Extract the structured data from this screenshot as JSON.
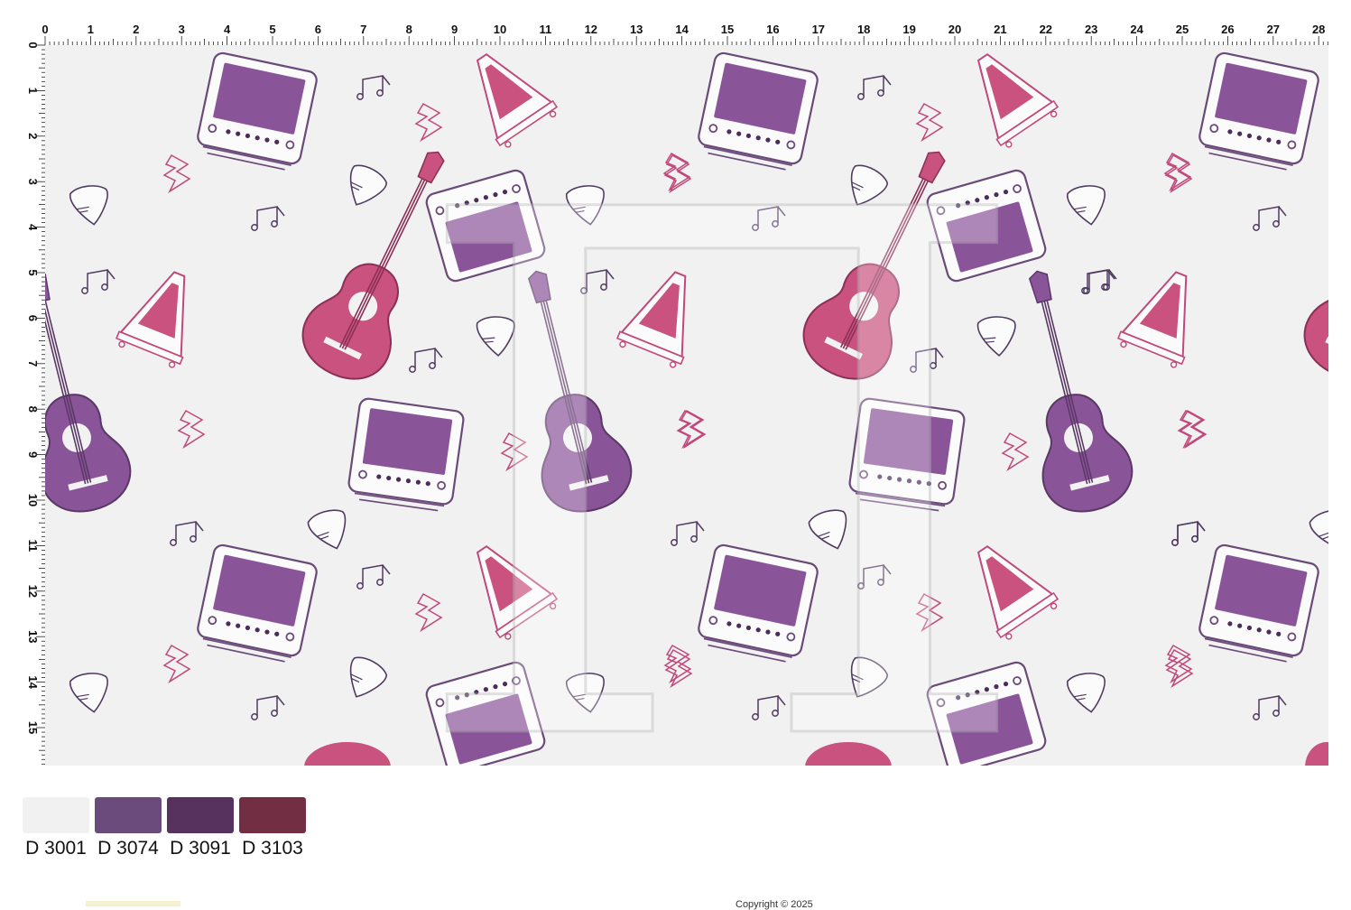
{
  "ruler": {
    "top_labels": [
      "0",
      "1",
      "2",
      "3",
      "4",
      "5",
      "6",
      "7",
      "8",
      "9",
      "10",
      "11",
      "12",
      "13",
      "14",
      "15",
      "16",
      "17",
      "18",
      "19",
      "20",
      "21",
      "22",
      "23",
      "24",
      "25",
      "26",
      "27",
      "28"
    ],
    "left_labels": [
      "0",
      "1",
      "2",
      "3",
      "4",
      "5",
      "6",
      "7",
      "8",
      "9",
      "10",
      "11",
      "12",
      "13",
      "14",
      "15"
    ]
  },
  "pattern": {
    "background_color": "#f1f1f1",
    "motifs": [
      "guitar-icon",
      "amplifier-icon",
      "metronome-icon",
      "guitar-pick-icon",
      "music-note-icon",
      "lightning-icon"
    ],
    "colors": {
      "purple": "#8a5499",
      "pink": "#c9527f",
      "outline_dark": "#4a2d58",
      "outline_pink": "#c0487a"
    },
    "watermark": "П"
  },
  "palette": {
    "swatches": [
      {
        "code": "D 3001",
        "color": "#f1f1f1"
      },
      {
        "code": "D 3074",
        "color": "#6b4b7b"
      },
      {
        "code": "D 3091",
        "color": "#57325e"
      },
      {
        "code": "D 3103",
        "color": "#722f44"
      }
    ]
  },
  "footer": {
    "copyright": "Copyright © 2025"
  }
}
